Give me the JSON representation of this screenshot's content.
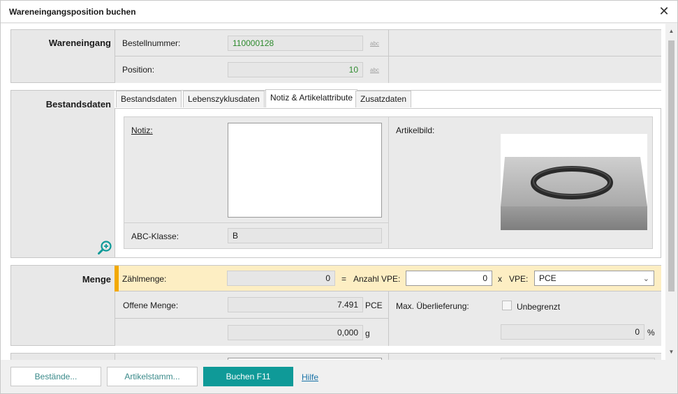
{
  "window": {
    "title": "Wareneingangsposition buchen",
    "close": "✕"
  },
  "wareneingang": {
    "title": "Wareneingang",
    "bestellnummer_label": "Bestellnummer:",
    "bestellnummer_value": "110000128",
    "position_label": "Position:",
    "position_value": "10",
    "abc_marker": "abc"
  },
  "bestandsdaten": {
    "title": "Bestandsdaten",
    "tabs": [
      "Bestandsdaten",
      "Lebenszyklusdaten",
      "Notiz & Artikelattribute",
      "Zusatzdaten"
    ],
    "active_tab": "Notiz & Artikelattribute",
    "notiz_label": "Notiz:",
    "notiz_value": "",
    "artikelbild_label": "Artikelbild:",
    "abc_klasse_label": "ABC-Klasse:",
    "abc_klasse_value": "B",
    "zoom_icon": "zoom-in-icon"
  },
  "menge": {
    "title": "Menge",
    "zaehlmenge_label": "Zählmenge:",
    "zaehlmenge_value": "0",
    "equals": "=",
    "anzahl_vpe_label": "Anzahl VPE:",
    "anzahl_vpe_value": "0",
    "times": "x",
    "vpe_label": "VPE:",
    "vpe_value": "PCE",
    "offene_menge_label": "Offene Menge:",
    "offene_menge_value": "7.491",
    "offene_menge_unit": "PCE",
    "gewicht_value": "0,000",
    "gewicht_unit": "g",
    "max_ueberlieferung_label": "Max. Überlieferung:",
    "unbegrenzt_label": "Unbegrenzt",
    "unbegrenzt_checked": false,
    "prozent_value": "0",
    "prozent_unit": "%"
  },
  "footer": {
    "bestaende": "Bestände...",
    "artikelstamm": "Artikelstamm...",
    "buchen": "Buchen F11",
    "hilfe": "Hilfe"
  },
  "colors": {
    "accent": "#0f9a98",
    "highlight_row": "#fdeec3",
    "highlight_bar": "#f2a900",
    "value_green": "#2e8b2e"
  }
}
